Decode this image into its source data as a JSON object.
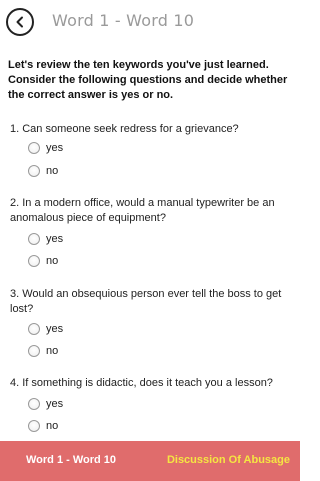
{
  "header": {
    "title": "Word 1 - Word 10",
    "back_icon": "chevron-left-icon"
  },
  "intro": "Let's review the ten keywords you've just learned. Consider the following questions and decide whether the correct answer is yes or no.",
  "questions": [
    {
      "text": "1. Can someone seek redress for a grievance?",
      "options": [
        "yes",
        "no"
      ]
    },
    {
      "text": "2. In a modern office, would a manual typewriter be an anomalous piece of equipment?",
      "options": [
        "yes",
        "no"
      ]
    },
    {
      "text": "3. Would an obsequious person ever tell the boss to get lost?",
      "options": [
        "yes",
        "no"
      ]
    },
    {
      "text": "4. If something is didactic, does it teach you a lesson?",
      "options": [
        "yes",
        "no"
      ]
    }
  ],
  "footer": {
    "left_label": "Word 1 - Word 10",
    "right_label": "Discussion Of Abusage",
    "background": "#e06c6c",
    "right_color": "#f5e642"
  }
}
